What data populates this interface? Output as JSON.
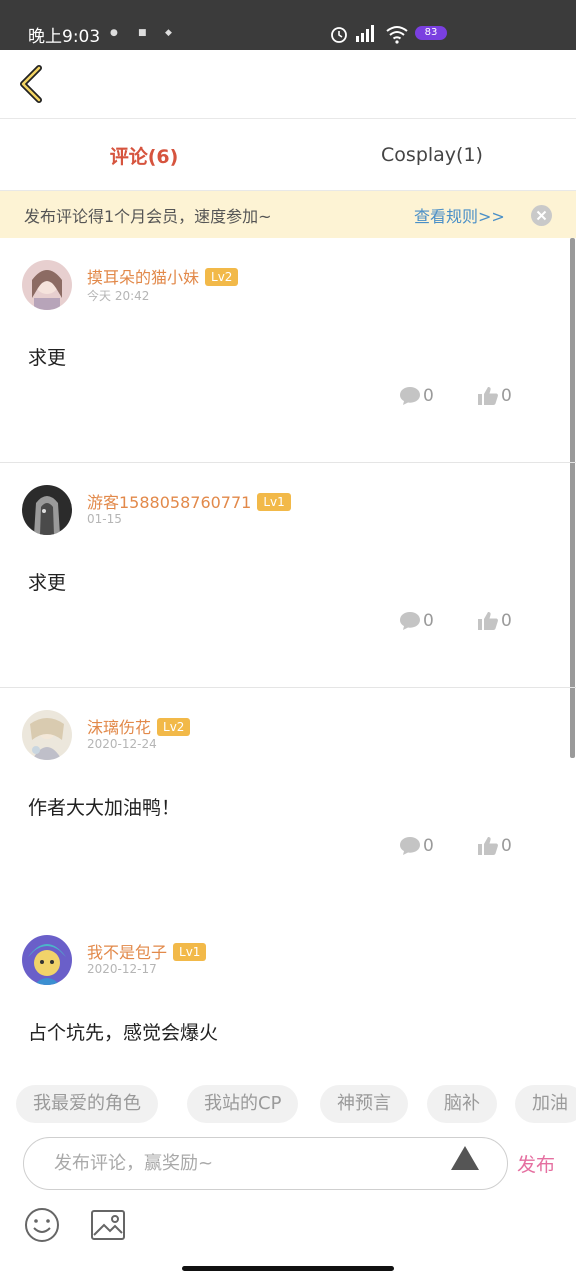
{
  "status_bar": {
    "time": "晚上9:03",
    "battery": "83"
  },
  "tabs": [
    {
      "label": "评论(6)"
    },
    {
      "label": "Cosplay(1)"
    }
  ],
  "banner": {
    "text": "发布评论得1个月会员，速度参加~",
    "link": "查看规则>>"
  },
  "comments": [
    {
      "user": "摸耳朵的猫小妹",
      "level": "Lv2",
      "time": "今天 20:42",
      "content": "求更",
      "replies": "0",
      "likes": "0"
    },
    {
      "user": "游客1588058760771",
      "level": "Lv1",
      "time": "01-15",
      "content": "求更",
      "replies": "0",
      "likes": "0"
    },
    {
      "user": "沫璃伤花",
      "level": "Lv2",
      "time": "2020-12-24",
      "content": "作者大大加油鸭！",
      "replies": "0",
      "likes": "0"
    },
    {
      "user": "我不是包子",
      "level": "Lv1",
      "time": "2020-12-17",
      "content": "占个坑先，感觉会爆火",
      "replies": "",
      "likes": ""
    }
  ],
  "chips": [
    "我最爱的角色",
    "我站的CP",
    "神预言",
    "脑补",
    "加油"
  ],
  "composer": {
    "placeholder": "发布评论，赢奖励~",
    "publish": "发布"
  },
  "colors": {
    "accent_red": "#d6543e",
    "username": "#e2894a",
    "level_badge": "#f2b949",
    "link": "#4a8fc7",
    "publish": "#e56fa0",
    "banner_bg": "#fdf3d4"
  }
}
